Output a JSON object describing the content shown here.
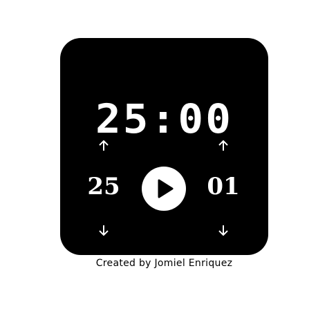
{
  "timer": {
    "display": "25:00",
    "minutes": "25",
    "breaks": "01"
  },
  "icons": {
    "play": "play-icon",
    "up": "arrow-up-icon",
    "down": "arrow-down-icon"
  },
  "footer": {
    "credit": "Created by Jomiel Enriquez"
  },
  "colors": {
    "card": "#000000",
    "text": "#ffffff",
    "background": "#ffffff"
  }
}
